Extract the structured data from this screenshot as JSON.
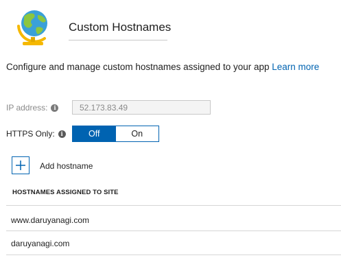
{
  "header": {
    "title": "Custom Hostnames",
    "icon": "globe-icon"
  },
  "description": {
    "text": "Configure and manage custom hostnames assigned to your app",
    "link": "Learn more"
  },
  "ip": {
    "label": "IP address:",
    "value": "52.173.83.49"
  },
  "https": {
    "label": "HTTPS Only:",
    "off_label": "Off",
    "on_label": "On",
    "selected": "Off"
  },
  "add_hostname": {
    "label": "Add hostname"
  },
  "hostnames": {
    "heading": "HOSTNAMES ASSIGNED TO SITE",
    "items": [
      "www.daruyanagi.com",
      "daruyanagi.com"
    ]
  },
  "colors": {
    "accent": "#0063b1",
    "globe_ocean": "#3aa0d8",
    "globe_land": "#8cc63f",
    "stand": "#f5b800"
  }
}
